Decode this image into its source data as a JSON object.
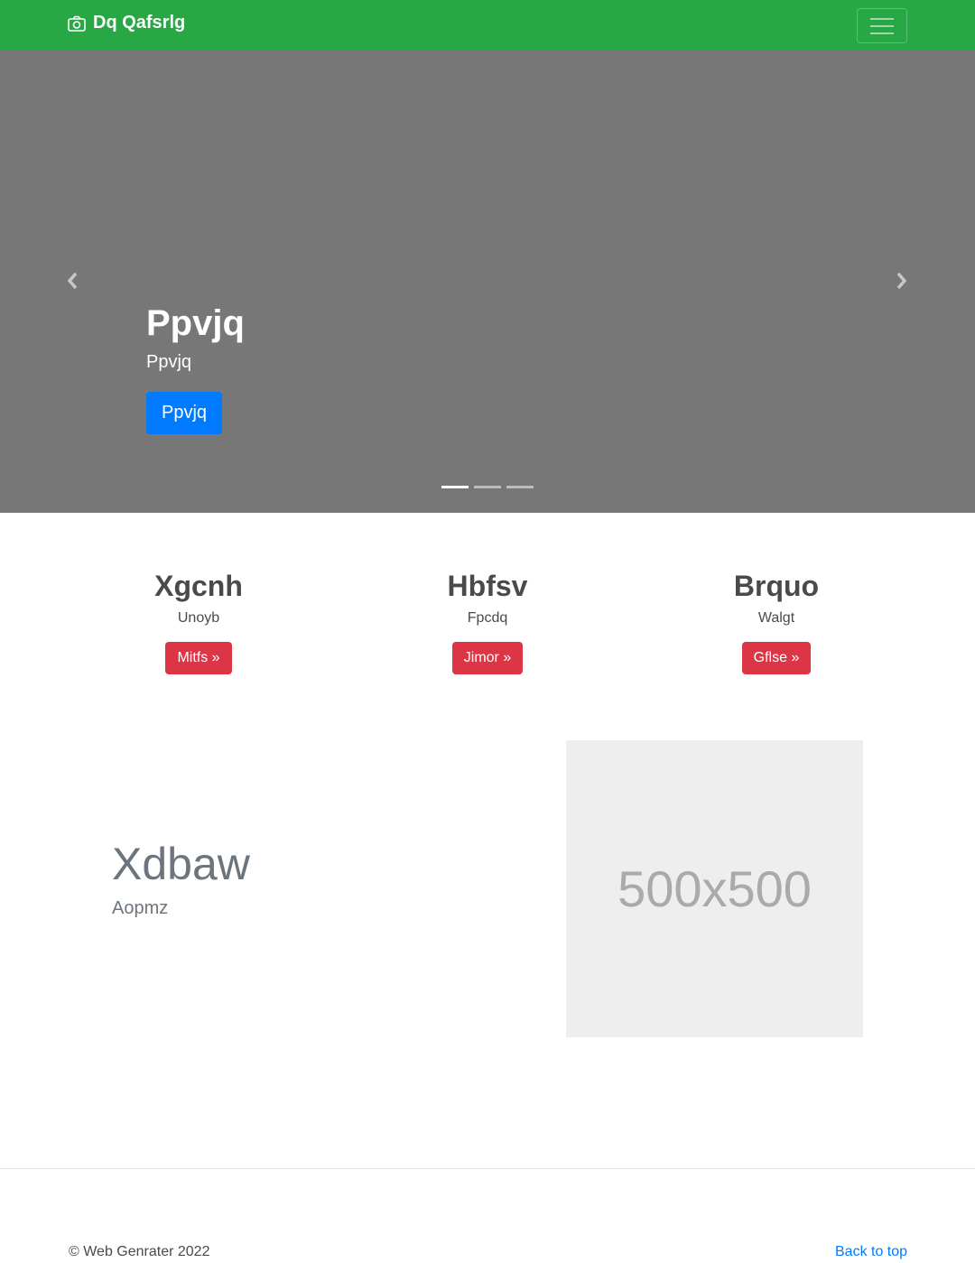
{
  "navbar": {
    "brand": "Dq Qafsrlg",
    "brand_icon": "camera-icon",
    "toggler_icon": "hamburger-menu-icon",
    "background_color": "#28a745"
  },
  "carousel": {
    "background_color": "#777777",
    "caption": {
      "heading": "Ppvjq",
      "text": "Ppvjq",
      "button": "Ppvjq"
    },
    "slide_count": 3,
    "active_slide": 1,
    "prev_icon": "chevron-left-icon",
    "next_icon": "chevron-right-icon"
  },
  "columns": [
    {
      "heading": "Xgcnh",
      "text": "Unoyb",
      "button": "Mitfs »"
    },
    {
      "heading": "Hbfsv",
      "text": "Fpcdq",
      "button": "Jimor »"
    },
    {
      "heading": "Brquo",
      "text": "Walgt",
      "button": "Gflse »"
    }
  ],
  "featurette": {
    "heading": "Xdbaw",
    "lead": "Aopmz",
    "placeholder_label": "500x500"
  },
  "footer": {
    "copyright": "© Web Genrater 2022",
    "back_to_top": "Back to top"
  }
}
